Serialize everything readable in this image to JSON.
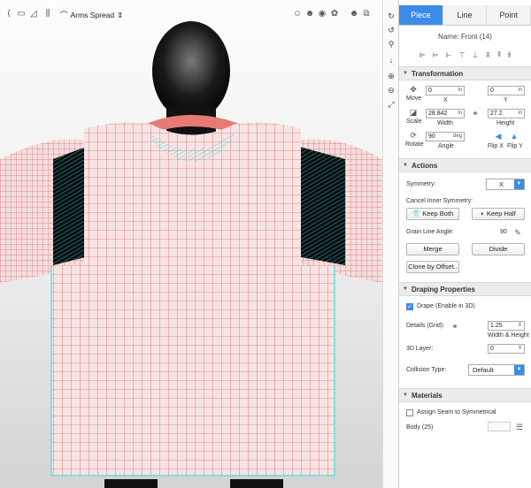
{
  "viewport": {
    "pose_label": "Arms Spread",
    "colors": {
      "grid": "#e23232",
      "edge": "#19e0e6",
      "body": "#111111",
      "garment": "#f2dede"
    }
  },
  "tabs": [
    {
      "label": "Piece",
      "active": true
    },
    {
      "label": "Line",
      "active": false
    },
    {
      "label": "Point",
      "active": false
    }
  ],
  "piece_name": "Name: Front (14)",
  "transformation": {
    "title": "Transformation",
    "move_label": "Move",
    "x_value": "0",
    "x_unit": "in",
    "x_label": "X",
    "y_value": "0",
    "y_unit": "in",
    "y_label": "Y",
    "scale_label": "Scale",
    "width_value": "28.842",
    "width_unit": "in",
    "width_label": "Width",
    "height_value": "27.2",
    "height_unit": "in",
    "height_label": "Height",
    "rotate_label": "Rotate",
    "angle_value": "90",
    "angle_unit": "deg",
    "angle_label": "Angle",
    "flip_x": "Flip X",
    "flip_y": "Flip Y"
  },
  "actions": {
    "title": "Actions",
    "symmetry_label": "Symmetry:",
    "symmetry_value": "X",
    "cancel_label": "Cancel Inner Symmetry:",
    "keep_both": "Keep Both",
    "keep_half": "Keep Half",
    "grain_label": "Grain Line Angle:",
    "grain_value": "90",
    "merge": "Merge",
    "divide": "Divide",
    "clone": "Clone by Offset.."
  },
  "draping": {
    "title": "Draping Properties",
    "drape_label": "Drape (Enable in 3D)",
    "drape_checked": true,
    "details_label": "Details (Grid):",
    "details_value": "1.25",
    "details_sub": "Width & Height",
    "layer_label": "3D Layer:",
    "layer_value": "0",
    "collision_label": "Collision Type:",
    "collision_value": "Default"
  },
  "materials": {
    "title": "Materials",
    "assign_label": "Assign Seam to Symmetrical",
    "assign_checked": false,
    "body_label": "Body (25)"
  }
}
